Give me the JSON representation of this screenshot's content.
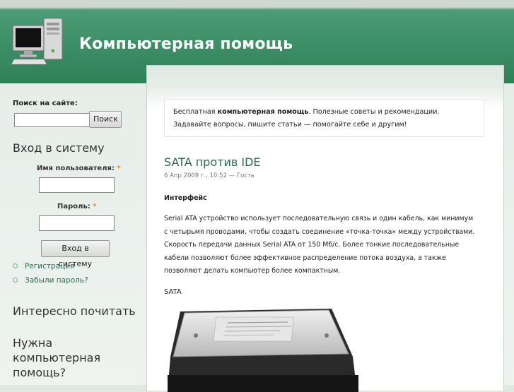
{
  "header": {
    "site_name": "Компьютерная помощь",
    "logo_icon": "computer-icon"
  },
  "sidebar": {
    "search": {
      "title": "Поиск на сайте:",
      "input_value": "",
      "button_label": "Поиск"
    },
    "login": {
      "title": "Вход в систему",
      "username_label": "Имя пользователя:",
      "password_label": "Пароль:",
      "required_mark": "*",
      "username_value": "",
      "password_value": "",
      "button_label": "Вход в систему",
      "links": [
        "Регистрация",
        "Забыли пароль?"
      ]
    },
    "interesting_title": "Интересно почитать",
    "help_title": "Нужна компьютерная помощь?"
  },
  "mission": {
    "prefix": "Бесплатная ",
    "bold": "компьютерная помощь",
    "suffix": ". Полезные советы и рекомендации.",
    "line2": "Задавайте вопросы, пишите статьи — помогайте себе и другим!"
  },
  "article": {
    "title": "SATA против IDE",
    "submitted": "6 Апр 2009 г., 10:52 — Гость",
    "subheading": "Интерфейс",
    "body": "Serial ATA устройство использует последовательную связь и один  кабель, как минимум с четырьмя проводами, чтобы создать соединение «точка-точка» между устройствами. Скорость передачи данных Serial ATA от 150 Мб/с. Более тонкие последовательные кабели позволяют более эффективное распределение потока воздуха, а также позволяют делать компьютер более компактным.",
    "image_caption": "SATA",
    "image_icon": "hard-drive-image"
  },
  "colors": {
    "header_green": "#3e9068",
    "link_green": "#2b6b4a",
    "required_orange": "#e09020"
  }
}
